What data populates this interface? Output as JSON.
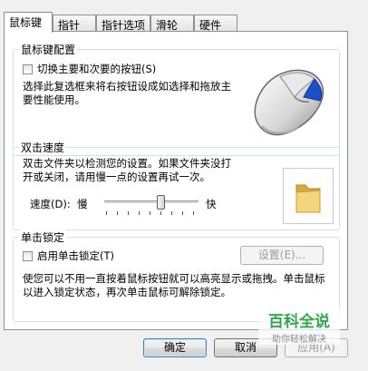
{
  "tabs": [
    {
      "label": "鼠标键",
      "active": true
    },
    {
      "label": "指针",
      "active": false
    },
    {
      "label": "指针选项",
      "active": false
    },
    {
      "label": "滑轮",
      "active": false
    },
    {
      "label": "硬件",
      "active": false
    }
  ],
  "button_config": {
    "title": "鼠标键配置",
    "checkbox_label": "切换主要和次要的按钮(S)",
    "checked": false,
    "description": "选择此复选框来将右按钮设成如选择和拖放主要性能使用。"
  },
  "double_click": {
    "title": "双击速度",
    "description": "双击文件夹以检测您的设置。如果文件夹没打开或关闭，请用慢一点的设置再试一次。",
    "speed_label": "速度(D):",
    "slow_label": "慢",
    "fast_label": "快",
    "speed_level": 0.6
  },
  "click_lock": {
    "title": "单击锁定",
    "checkbox_label": "启用单击锁定(T)",
    "checked": false,
    "settings_button": "设置(E)...",
    "description": "使您可以不用一直按着鼠标按钮就可以高亮显示或拖拽。单击鼠标以进入锁定状态，再次单击鼠标可解除锁定。"
  },
  "footer": {
    "ok": "确定",
    "cancel": "取消",
    "apply": "应用(A)"
  },
  "watermark": {
    "main": "百科全说",
    "sub": "助你轻松解决"
  },
  "colors": {
    "folder": "#e9c25b",
    "mouse_accent": "#1f4fc4",
    "watermark_green": "#2eaa4a"
  }
}
